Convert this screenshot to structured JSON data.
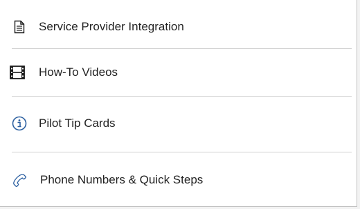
{
  "menu": {
    "items": [
      {
        "label": "Service Provider Integration",
        "icon": "document-icon"
      },
      {
        "label": "How-To Videos",
        "icon": "film-icon"
      },
      {
        "label": "Pilot Tip Cards",
        "icon": "info-icon"
      },
      {
        "label": "Phone Numbers & Quick Steps",
        "icon": "phone-icon"
      }
    ]
  },
  "colors": {
    "text": "#222222",
    "icon": "#1a1a1a",
    "info_icon": "#2b5fa0",
    "phone_icon": "#2b5fa0",
    "divider": "#d0d0d0",
    "border": "#bfbfbf"
  }
}
